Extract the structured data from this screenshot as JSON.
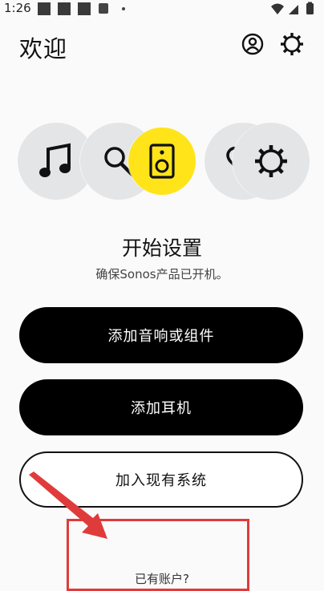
{
  "status": {
    "time": "1:26"
  },
  "header": {
    "title": "欢迎",
    "account_icon": "account-circle-icon",
    "settings_icon": "gear-icon"
  },
  "feature_icons": [
    "music-note-icon",
    "search-icon",
    "speaker-icon",
    "heart-icon",
    "settings-gear-icon"
  ],
  "setup": {
    "heading": "开始设置",
    "subtitle": "确保Sonos产品已开机。"
  },
  "buttons": {
    "add_speaker": "添加音响或组件",
    "add_headphones": "添加耳机",
    "join_system": "加入现有系统"
  },
  "footer": {
    "have_account": "已有账户?"
  },
  "colors": {
    "accent_yellow": "#ffe419",
    "highlight_red": "#e03b3b"
  }
}
